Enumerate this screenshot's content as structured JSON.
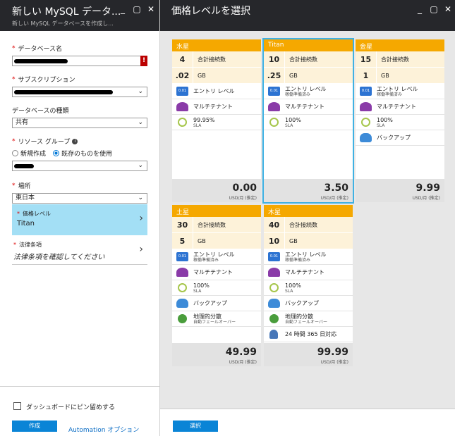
{
  "left": {
    "title": "新しい MySQL データ...",
    "subtitle": "新しい MySQL データベースを作成し...",
    "db_label": "データベース名",
    "sub_label": "サブスクリプション",
    "type_label": "データベースの種類",
    "type_value": "共有",
    "rg_label": "リソース グループ",
    "rg_new": "新規作成",
    "rg_existing": "既存のものを使用",
    "loc_label": "場所",
    "loc_value": "東日本",
    "price_label": "価格レベル",
    "price_value": "Titan",
    "terms_label": "法律条項",
    "terms_value": "法律条項を確認してください",
    "pin_label": "ダッシュボードにピン留めする",
    "create_label": "作成",
    "automation_label": "Automation オプション",
    "err_mark": "!"
  },
  "right": {
    "title": "価格レベルを選択",
    "select_label": "選択"
  },
  "feat": {
    "conn": "合計接続数",
    "gb": "GB",
    "entry": "エントリ レベル",
    "entry_sub": "稼働準備済み",
    "multi": "マルチテナント",
    "sla": "SLA",
    "backup": "バックアップ",
    "geo": "地理的分散",
    "geo_sub": "自動フェールオーバー",
    "support": "24 時間 365 日対応",
    "unit": "USD/月 (推定)"
  },
  "tiers": [
    {
      "name": "水星",
      "conn": "4",
      "gb": ".02",
      "sla": "99.95%",
      "price": "0.00"
    },
    {
      "name": "Titan",
      "conn": "10",
      "gb": ".25",
      "sla": "100%",
      "price": "3.50"
    },
    {
      "name": "金星",
      "conn": "15",
      "gb": "1",
      "sla": "100%",
      "price": "9.99"
    },
    {
      "name": "土星",
      "conn": "30",
      "gb": "5",
      "sla": "100%",
      "price": "49.99"
    },
    {
      "name": "木星",
      "conn": "40",
      "gb": "10",
      "sla": "100%",
      "price": "99.99"
    }
  ],
  "colors": {
    "accent": "#0a84d6",
    "tier_header": "#f5a800",
    "selected": "#a3dff5"
  }
}
